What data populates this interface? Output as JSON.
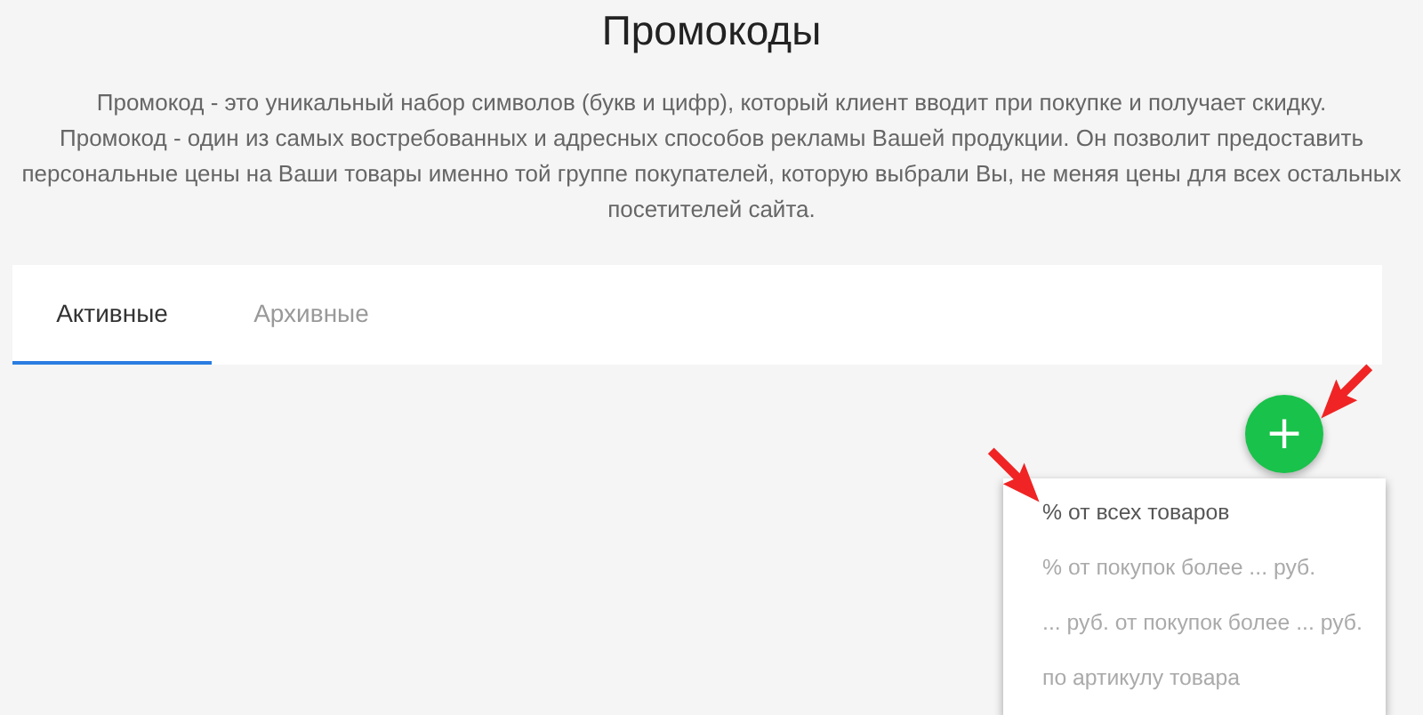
{
  "title": "Промокоды",
  "description": [
    "Промокод - это уникальный набор символов (букв и цифр), который клиент вводит при покупке и получает скидку.",
    "Промокод - один из самых востребованных и адресных способов рекламы Вашей продукции. Он позволит предоставить персональные цены на Ваши товары именно той группе покупателей, которую выбрали Вы, не меняя цены для всех остальных посетителей сайта."
  ],
  "tabs": [
    {
      "label": "Активные",
      "selected": true
    },
    {
      "label": "Архивные",
      "selected": false
    }
  ],
  "add_button": {
    "label": "+"
  },
  "menu": [
    {
      "label": "% от всех товаров",
      "selected": true
    },
    {
      "label": "% от покупок более ... руб.",
      "selected": false
    },
    {
      "label": "... руб. от покупок более ... руб.",
      "selected": false
    },
    {
      "label": "по артикулу товара",
      "selected": false
    }
  ]
}
